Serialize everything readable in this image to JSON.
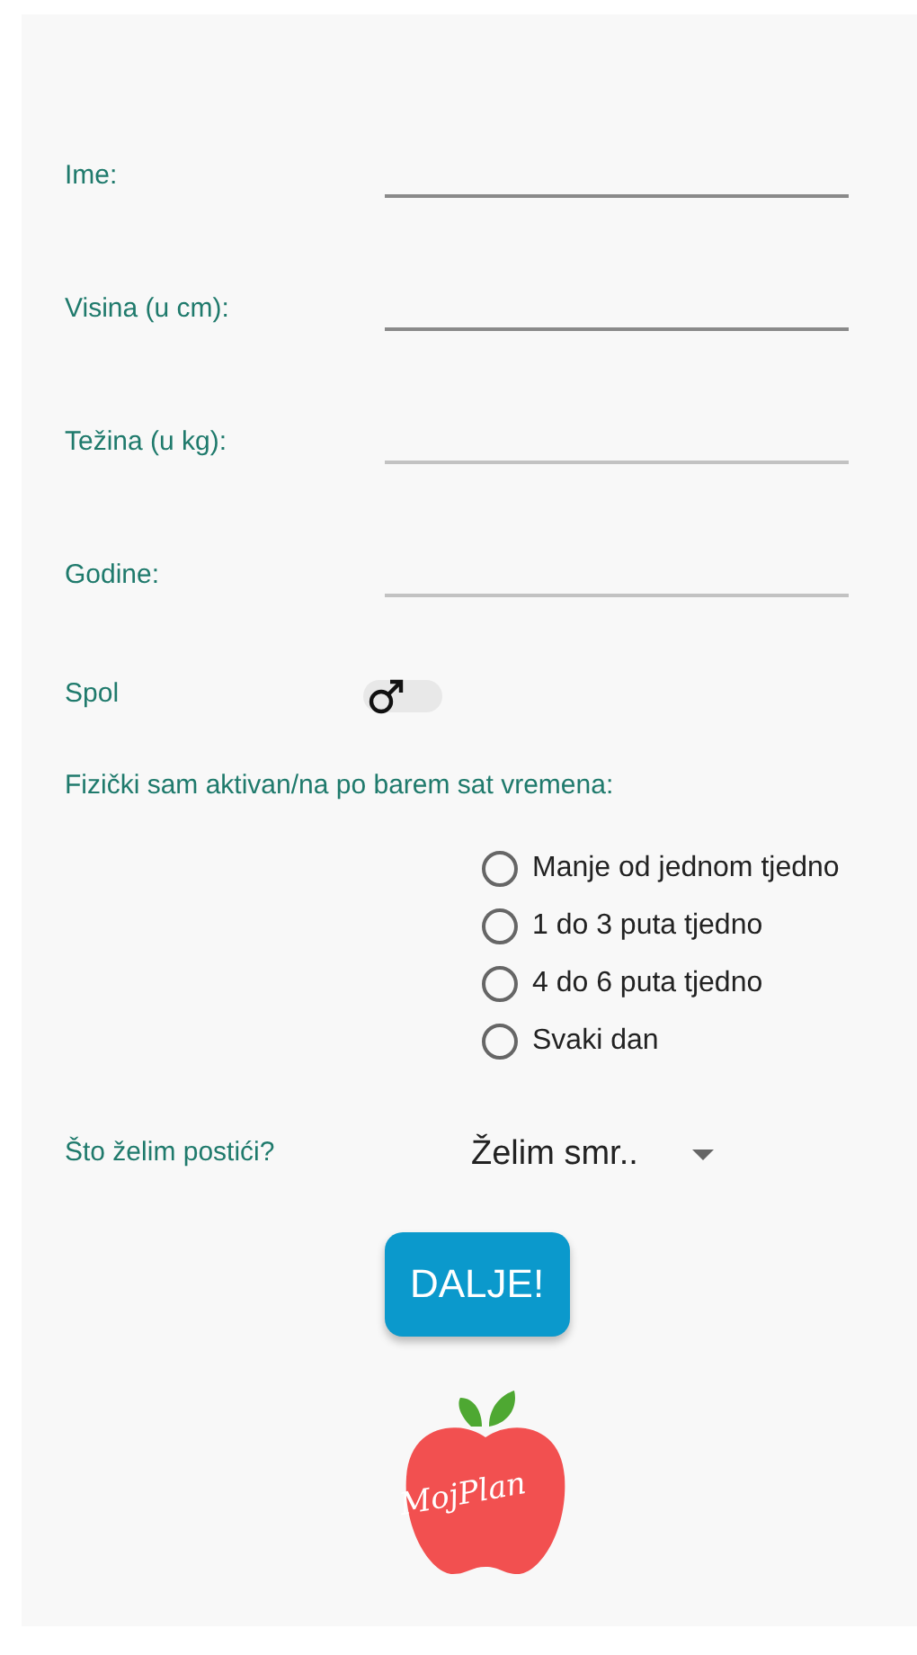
{
  "fields": [
    {
      "label": "Ime:"
    },
    {
      "label": "Visina (u cm):"
    },
    {
      "label": "Težina (u kg):"
    },
    {
      "label": "Godine:"
    }
  ],
  "gender": {
    "label": "Spol",
    "on": false
  },
  "activity": {
    "question": "Fizički sam aktivan/na po barem sat vremena:",
    "options": [
      {
        "label": "Manje od jednom tjedno",
        "selected": false
      },
      {
        "label": "1 do 3 puta tjedno",
        "selected": false
      },
      {
        "label": "4 do 6 puta tjedno",
        "selected": false
      },
      {
        "label": "Svaki dan",
        "selected": false
      }
    ]
  },
  "goal": {
    "label": "Što želim postići?",
    "value": "Želim smr.."
  },
  "button": "DALJE!",
  "logo": {
    "text": "MojPlan"
  }
}
